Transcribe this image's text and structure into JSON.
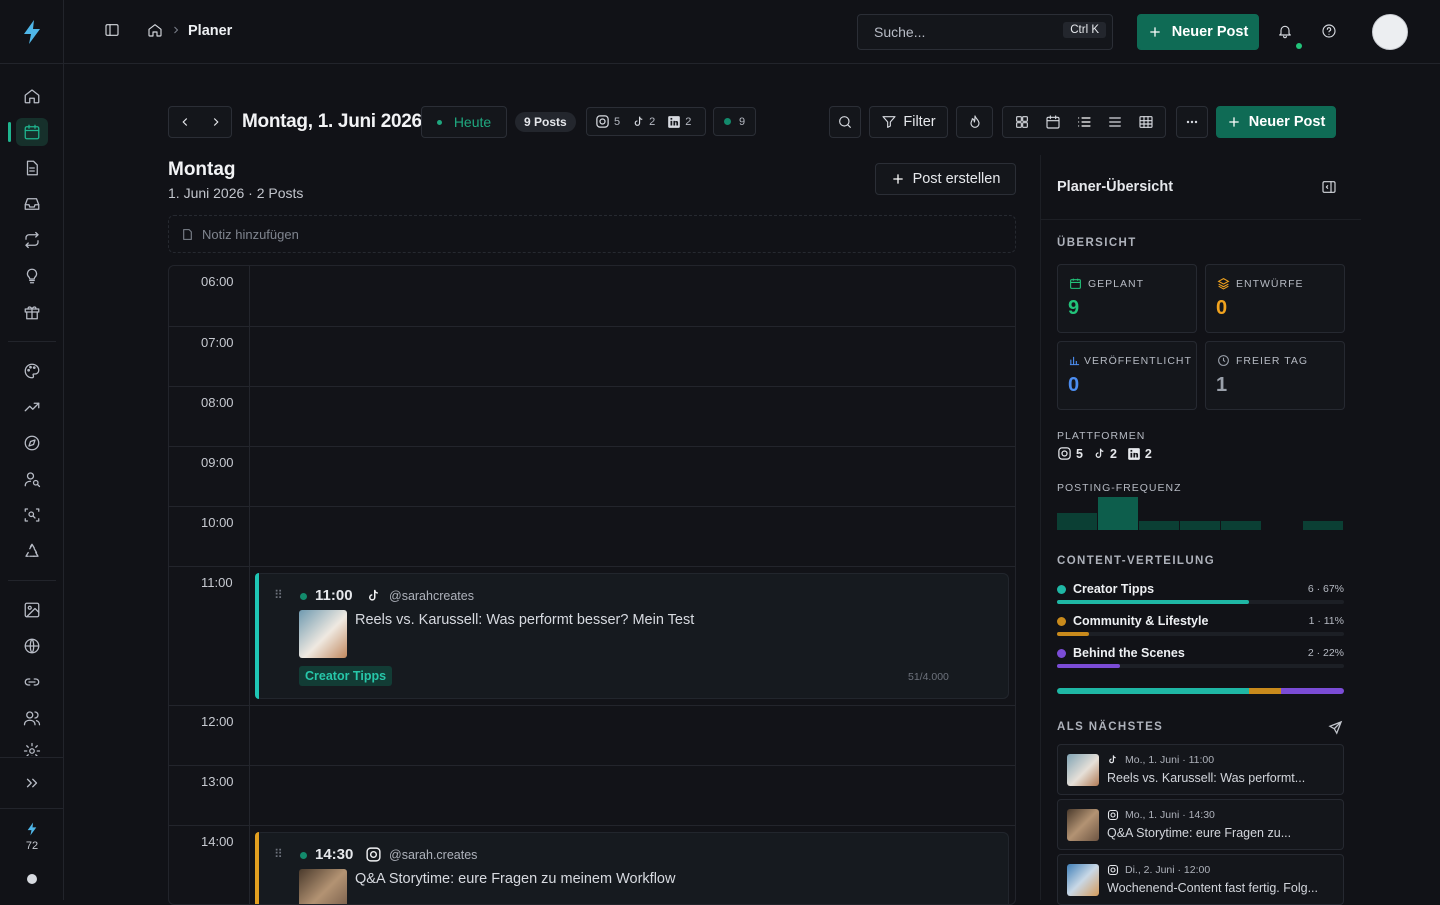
{
  "topbar": {
    "breadcrumb_current": "Planer",
    "search_placeholder": "Suche...",
    "search_shortcut": "Ctrl K",
    "new_post_label": "Neuer Post"
  },
  "rail": {
    "credits": "72"
  },
  "toolbar": {
    "date_title": "Montag, 1. Juni 2026",
    "today_label": "Heute",
    "posts_badge": "9 Posts",
    "instagram_count": "5",
    "tiktok_count": "2",
    "linkedin_count": "2",
    "status_count": "9",
    "filter_label": "Filter",
    "new_post_label": "Neuer Post"
  },
  "day": {
    "title": "Montag",
    "subtitle": "1. Juni 2026 · 2 Posts",
    "create_post_label": "Post erstellen",
    "note_placeholder": "Notiz hinzufügen"
  },
  "timeline": {
    "hours": [
      "06:00",
      "07:00",
      "08:00",
      "09:00",
      "10:00",
      "11:00",
      "12:00",
      "13:00",
      "14:00"
    ],
    "posts": [
      {
        "time": "11:00",
        "platform": "tiktok",
        "handle": "@sarahcreates",
        "title": "Reels vs. Karussell: Was performt besser? Mein Test",
        "category": "Creator Tipps",
        "chars": "51/4.000",
        "bar_color": "#1fc6b4"
      },
      {
        "time": "14:30",
        "platform": "instagram",
        "handle": "@sarah.creates",
        "title": "Q&A Storytime: eure Fragen zu meinem Workflow",
        "category": "",
        "chars": "",
        "bar_color": "#e3a020"
      }
    ]
  },
  "sidebar": {
    "title": "Planer-Übersicht",
    "overview_label": "ÜBERSICHT",
    "stats": [
      {
        "label": "GEPLANT",
        "value": "9",
        "color": "#22c37a"
      },
      {
        "label": "ENTWÜRFE",
        "value": "0",
        "color": "#f0a21e"
      },
      {
        "label": "VERÖFFENTLICHT",
        "value": "0",
        "color": "#4c8df0"
      },
      {
        "label": "FREIER TAG",
        "value": "1",
        "color": "#9aa0aa"
      }
    ],
    "platforms_label": "PLATTFORMEN",
    "platforms": {
      "instagram": "5",
      "tiktok": "2",
      "linkedin": "2"
    },
    "frequency_label": "POSTING-FREQUENZ",
    "frequency": [
      2,
      4,
      1,
      1,
      1,
      0,
      1
    ],
    "distribution_label": "CONTENT-VERTEILUNG",
    "distribution": [
      {
        "name": "Creator Tipps",
        "stat": "6 · 67%",
        "percent": 67,
        "color": "#1fb7a5"
      },
      {
        "name": "Community & Lifestyle",
        "stat": "1 · 11%",
        "percent": 11,
        "color": "#c98a1c"
      },
      {
        "name": "Behind the Scenes",
        "stat": "2 · 22%",
        "percent": 22,
        "color": "#7b4cd6"
      }
    ],
    "next_label": "ALS NÄCHSTES",
    "upcoming": [
      {
        "platform": "tiktok",
        "date": "Mo., 1. Juni · 11:00",
        "title": "Reels vs. Karussell: Was performt..."
      },
      {
        "platform": "instagram",
        "date": "Mo., 1. Juni · 14:30",
        "title": "Q&A Storytime: eure Fragen zu..."
      },
      {
        "platform": "instagram",
        "date": "Di., 2. Juni · 12:00",
        "title": "Wochenend-Content fast fertig. Folg..."
      }
    ]
  },
  "colors": {
    "accent": "#1fb58f",
    "button_green": "#0f6b55",
    "background": "#111217"
  }
}
